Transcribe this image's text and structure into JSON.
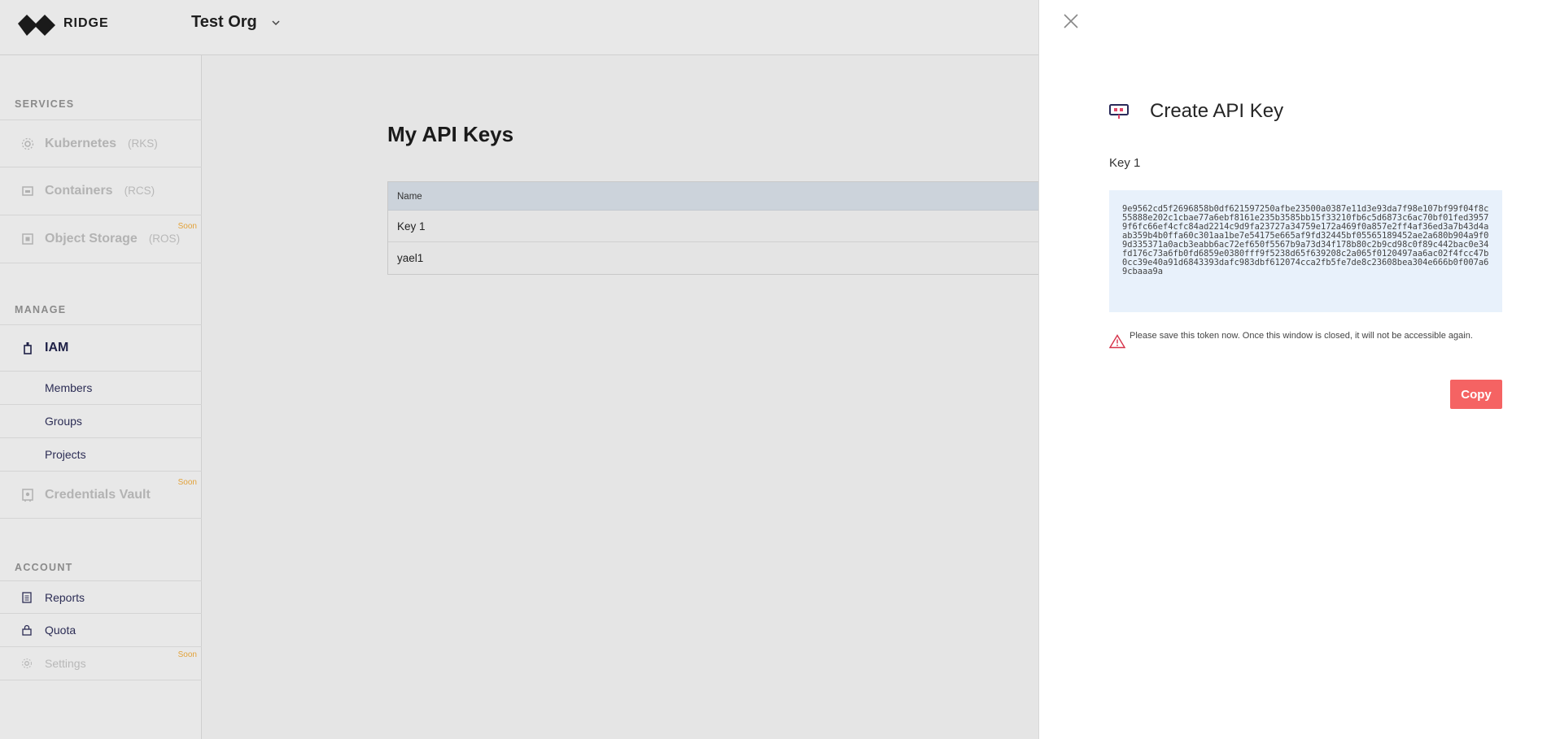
{
  "brand": {
    "name": "RIDGE"
  },
  "org": {
    "name": "Test Org"
  },
  "sidebar": {
    "services_title": "SERVICES",
    "services": [
      {
        "label": "Kubernetes",
        "abbr": "(RKS)",
        "soon": ""
      },
      {
        "label": "Containers",
        "abbr": "(RCS)",
        "soon": ""
      },
      {
        "label": "Object Storage",
        "abbr": "(ROS)",
        "soon": "Soon"
      }
    ],
    "manage_title": "MANAGE",
    "iam": {
      "label": "IAM"
    },
    "iam_items": [
      {
        "label": "Members"
      },
      {
        "label": "Groups"
      },
      {
        "label": "Projects"
      }
    ],
    "vault": {
      "label": "Credentials Vault",
      "soon": "Soon"
    },
    "account_title": "ACCOUNT",
    "account_items": [
      {
        "label": "Reports",
        "soon": ""
      },
      {
        "label": "Quota",
        "soon": ""
      },
      {
        "label": "Settings",
        "soon": "Soon"
      }
    ]
  },
  "main": {
    "title": "My API Keys",
    "table": {
      "header": "Name",
      "rows": [
        {
          "name": "Key 1"
        },
        {
          "name": "yael1"
        }
      ]
    }
  },
  "drawer": {
    "title": "Create API Key",
    "key_name": "Key 1",
    "token": "9e9562cd5f2696858b0df621597250afbe23500a0387e11d3e93da7f98e107bf99f04f8c55888e202c1cbae77a6ebf8161e235b3585bb15f33210fb6c5d6873c6ac70bf01fed39579f6fc66ef4cfc84ad2214c9d9fa23727a34759e172a469f0a857e2ff4af36ed3a7b43d4aab359b4b0ffa60c301aa1be7e54175e665af9fd32445bf05565189452ae2a680b904a9f09d335371a0acb3eabb6ac72ef650f5567b9a73d34f178b80c2b9cd98c0f89c442bac0e34fd176c73a6fb0fd6859e0380fff9f5238d65f639208c2a065f0120497aa6ac02f4fcc47b0cc39e40a91d6843393dafc983dbf612074cca2fb5fe7de8c23608bea304e666b0f007a69cbaaa9a",
    "warning": "Please save this token now. Once this window is closed, it will not be accessible again.",
    "copy_label": "Copy"
  },
  "colors": {
    "accent": "#f56363",
    "nav_active": "#1f2147",
    "soon": "#e2a23a",
    "token_bg": "#e8f1fb"
  }
}
